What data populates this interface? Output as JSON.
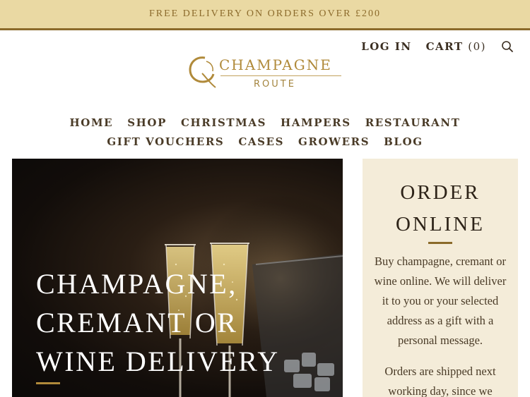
{
  "promo": {
    "text": "FREE DELIVERY ON ORDERS OVER £200"
  },
  "header": {
    "login_label": "LOG IN",
    "cart_label": "CART",
    "cart_count": "(0)",
    "search_icon": "search-icon"
  },
  "logo": {
    "main": "CHAMPAGNE",
    "sub": "ROUTE",
    "mark": "Q"
  },
  "nav": {
    "row1": [
      "HOME",
      "SHOP",
      "CHRISTMAS",
      "HAMPERS",
      "RESTAURANT"
    ],
    "row2": [
      "GIFT VOUCHERS",
      "CASES",
      "GROWERS",
      "BLOG"
    ]
  },
  "hero": {
    "title_lines": [
      "CHAMPAGNE,",
      "CREMANT OR",
      "WINE DELIVERY"
    ]
  },
  "order": {
    "title_lines": [
      "ORDER",
      "ONLINE"
    ],
    "paragraph1": "Buy champagne, cremant or wine online. We will deliver it to you or your selected address as a gift with a personal message.",
    "paragraph2": "Orders are shipped next working day, since we"
  },
  "colors": {
    "promo_bg": "#ead9a3",
    "accent_gold": "#b08a3a",
    "card_bg": "#f4ecd9",
    "nav_text": "#4a3b27"
  }
}
